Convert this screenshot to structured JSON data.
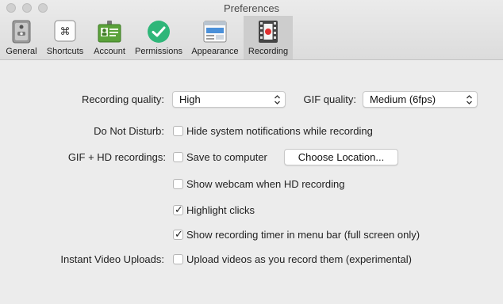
{
  "window": {
    "title": "Preferences"
  },
  "tabs": [
    {
      "label": "General",
      "icon": "switch-icon"
    },
    {
      "label": "Shortcuts",
      "icon": "command-key-icon"
    },
    {
      "label": "Account",
      "icon": "id-card-icon"
    },
    {
      "label": "Permissions",
      "icon": "checkmark-badge-icon"
    },
    {
      "label": "Appearance",
      "icon": "window-layout-icon"
    },
    {
      "label": "Recording",
      "icon": "film-record-icon",
      "active": true
    }
  ],
  "settings": {
    "recording_quality": {
      "label": "Recording quality:",
      "value": "High"
    },
    "gif_quality": {
      "label": "GIF quality:",
      "value": "Medium (6fps)"
    },
    "do_not_disturb": {
      "label": "Do Not Disturb:",
      "option": "Hide system notifications while recording",
      "checked": false
    },
    "gif_hd": {
      "label": "GIF + HD recordings:",
      "save_option": "Save to computer",
      "save_checked": false,
      "choose_location_button": "Choose Location...",
      "webcam_option": "Show webcam when HD recording",
      "webcam_checked": false,
      "highlight_option": "Highlight clicks",
      "highlight_checked": true,
      "timer_option": "Show recording timer in menu bar (full screen only)",
      "timer_checked": true
    },
    "instant_uploads": {
      "label": "Instant Video Uploads:",
      "option": "Upload videos as you record them (experimental)",
      "checked": false
    }
  },
  "colors": {
    "active_tab_bg": "#cdcdcd",
    "permissions_green": "#2fb679",
    "record_red": "#e0302f"
  }
}
